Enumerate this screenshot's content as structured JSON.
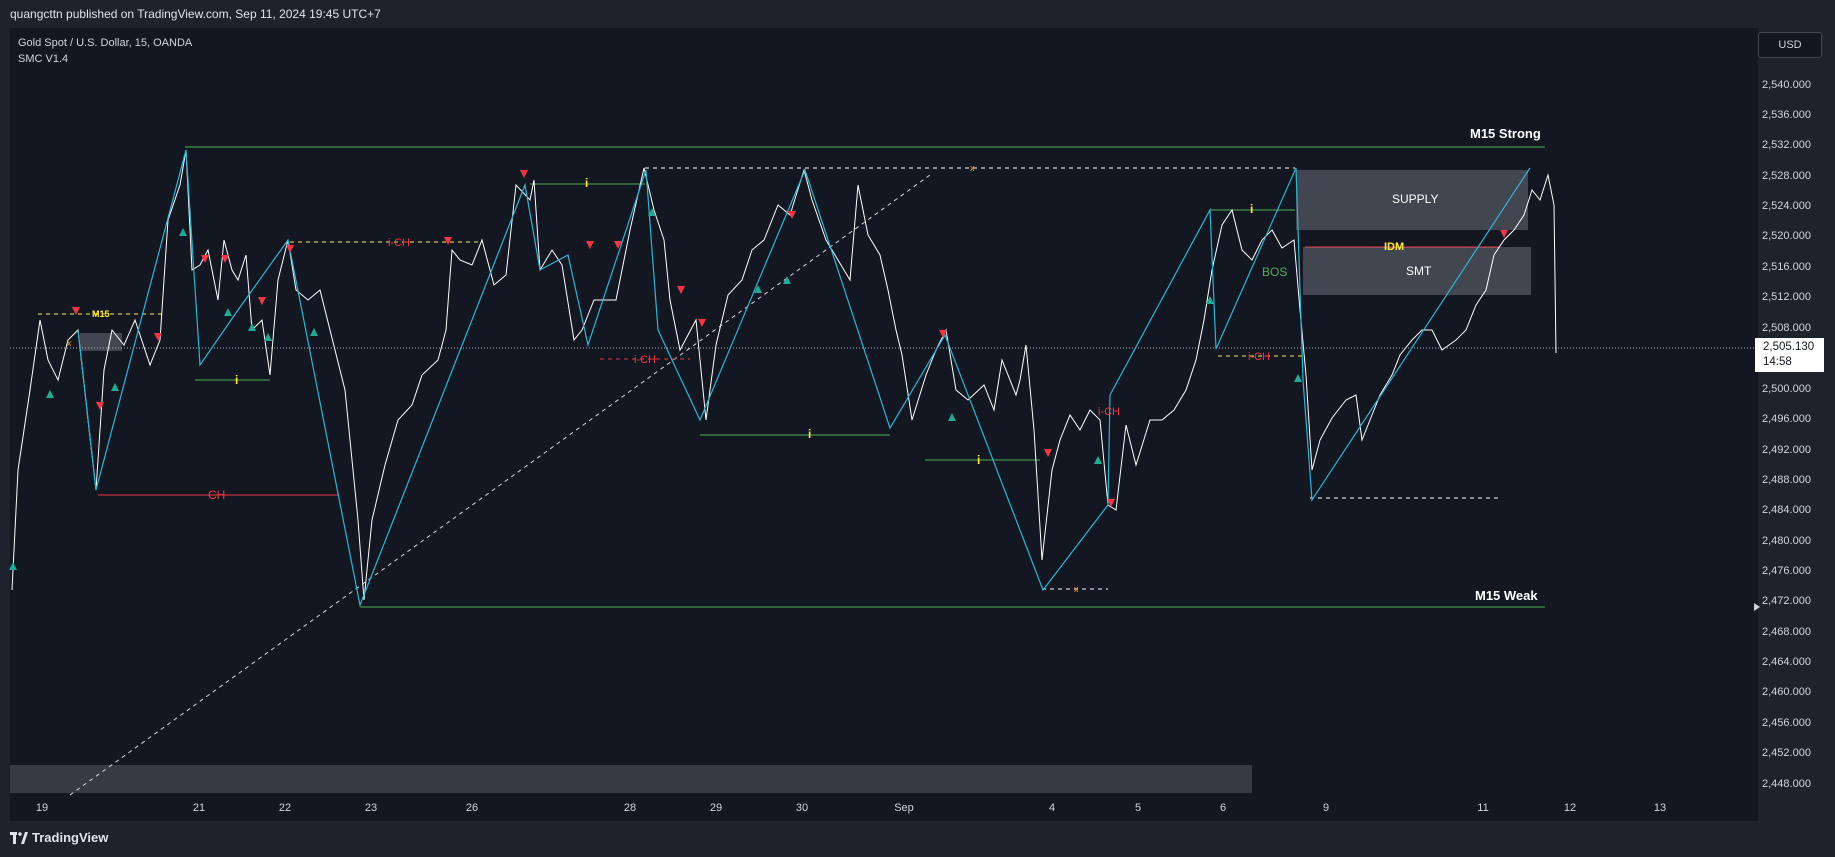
{
  "header": {
    "publisher": "quangcttn published on TradingView.com, Sep 11, 2024 19:45 UTC+7"
  },
  "legend": {
    "symbol": "Gold Spot / U.S. Dollar, 15, OANDA",
    "indicator": "SMC V1.4"
  },
  "currency_button": "USD",
  "last_price": {
    "value": "2,505.130",
    "countdown": "14:58"
  },
  "price_axis": [
    "2,540.000",
    "2,536.000",
    "2,532.000",
    "2,528.000",
    "2,524.000",
    "2,520.000",
    "2,516.000",
    "2,512.000",
    "2,508.000",
    "2,500.000",
    "2,496.000",
    "2,492.000",
    "2,488.000",
    "2,484.000",
    "2,480.000",
    "2,476.000",
    "2,472.000",
    "2,468.000",
    "2,464.000",
    "2,460.000",
    "2,456.000",
    "2,452.000",
    "2,448.000"
  ],
  "time_axis": [
    "19",
    "21",
    "22",
    "23",
    "26",
    "28",
    "29",
    "30",
    "Sep",
    "4",
    "5",
    "6",
    "9",
    "11",
    "12",
    "13"
  ],
  "annotations": {
    "strong": "M15 Strong",
    "weak": "M15 Weak",
    "supply": "SUPPLY",
    "smt": "SMT",
    "idm": "IDM",
    "bos": "BOS",
    "ch": "CH",
    "ich": "i-CH",
    "i": "i",
    "m15": "M15",
    "x": "x"
  },
  "brand": "TradingView",
  "colors": {
    "background": "#131722",
    "up": "#22ab94",
    "down": "#f23645",
    "zigzag": "#2fb5d2",
    "strong": "#4caf50",
    "idm": "#ffeb3b"
  }
}
